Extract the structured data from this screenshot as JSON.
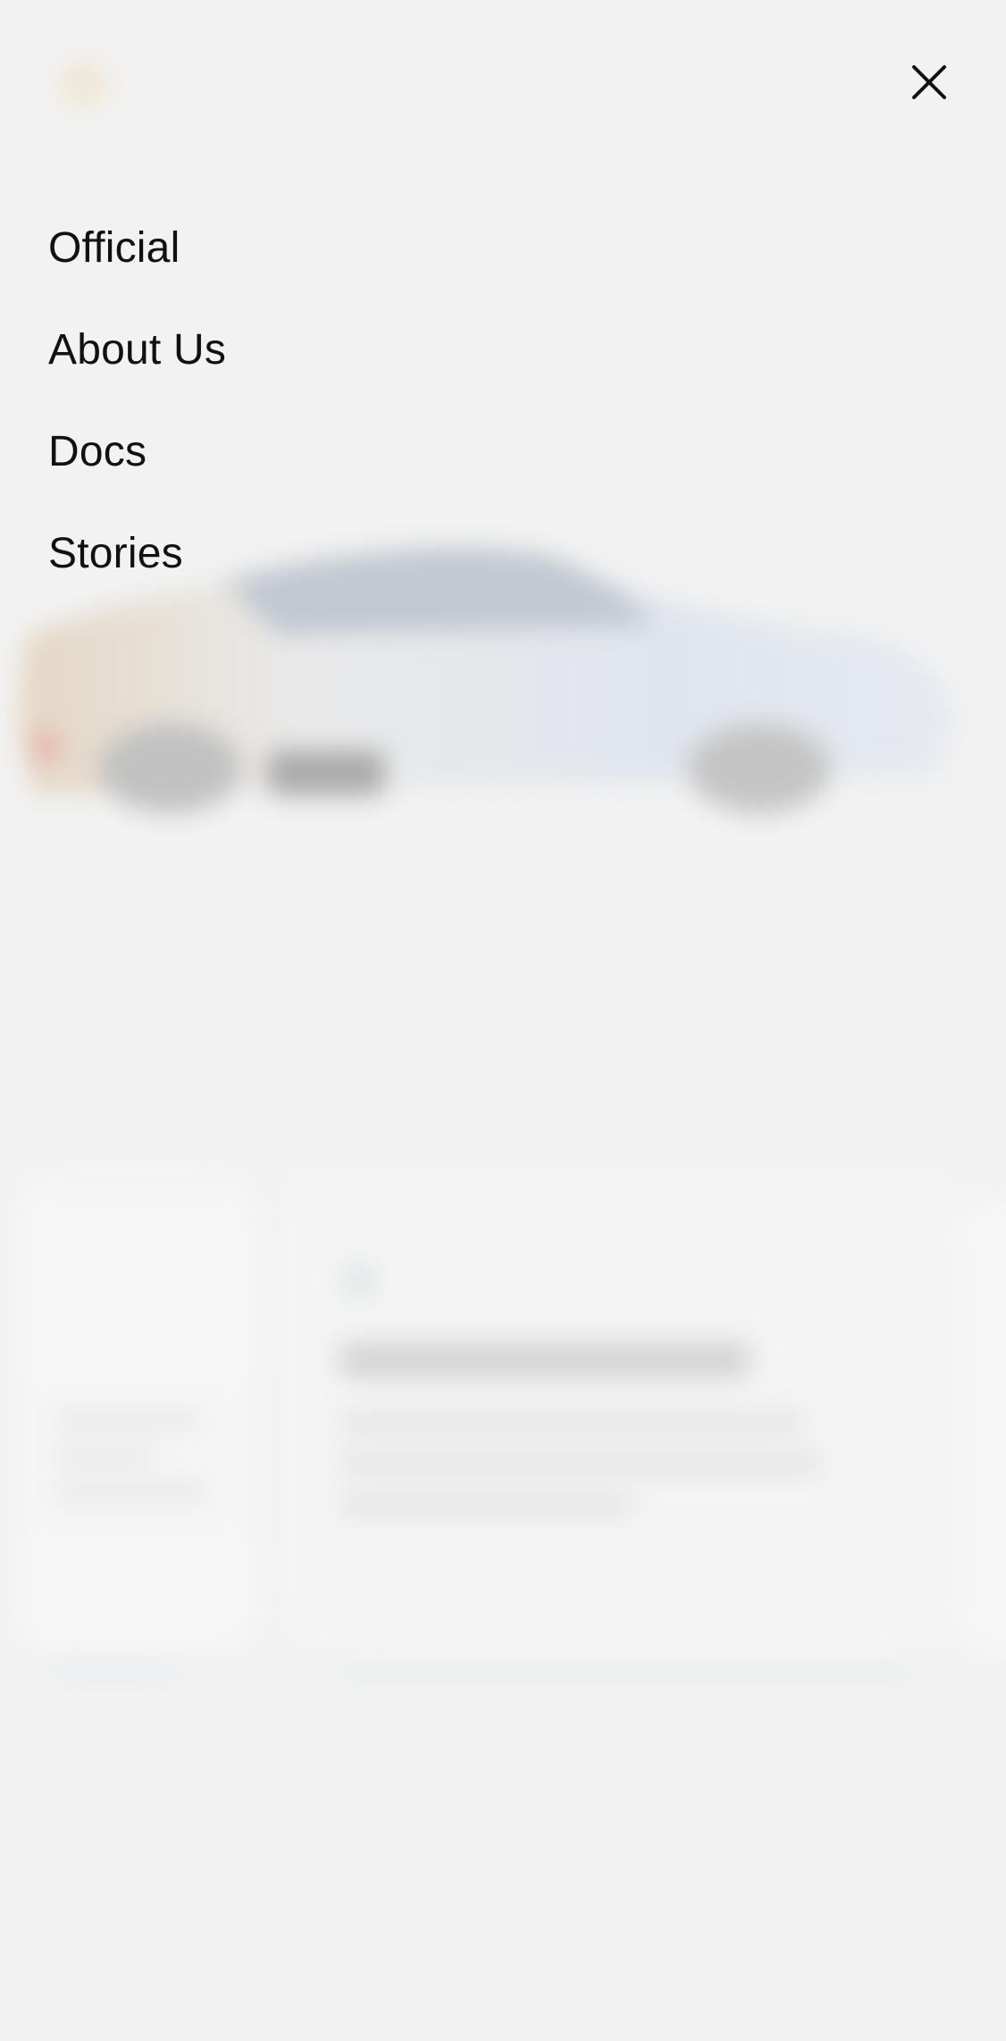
{
  "menu": {
    "items": [
      {
        "label": "Official"
      },
      {
        "label": "About Us"
      },
      {
        "label": "Docs"
      },
      {
        "label": "Stories"
      }
    ],
    "close_icon": "close-icon"
  },
  "colors": {
    "background": "#f2f2f2",
    "menu_text": "#111111",
    "close_icon": "#111111",
    "logo_accent": "#e9d3a8"
  }
}
